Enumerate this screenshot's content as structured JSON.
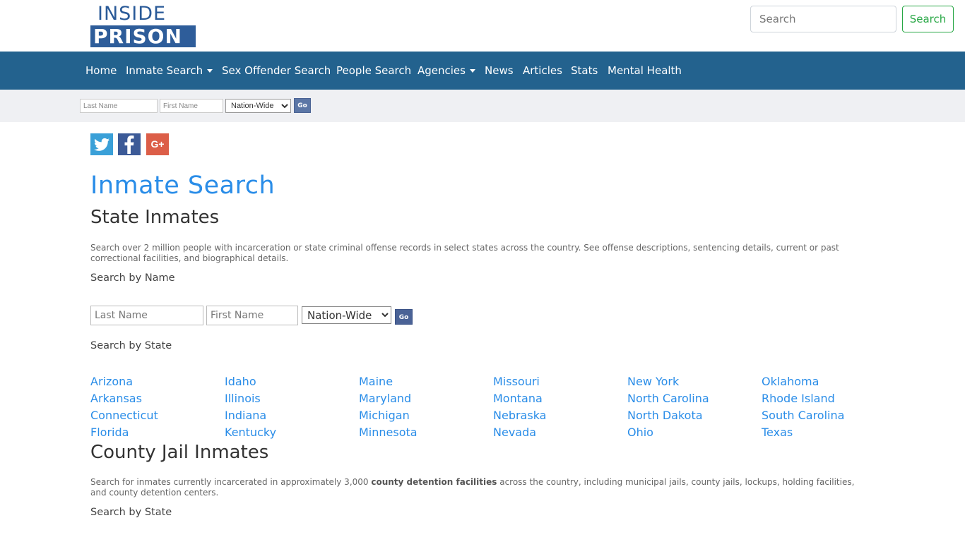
{
  "logo": {
    "top_text": "INSIDE",
    "bottom_text": "PRISON"
  },
  "nav": {
    "items": [
      {
        "label": "Home",
        "dropdown": false
      },
      {
        "label": "Inmate Search",
        "dropdown": true
      },
      {
        "label": "Sex Offender Search",
        "dropdown": false
      },
      {
        "label": "People Search",
        "dropdown": false
      },
      {
        "label": "Agencies",
        "dropdown": true
      },
      {
        "label": "News",
        "dropdown": false
      },
      {
        "label": "Articles",
        "dropdown": false
      },
      {
        "label": "Stats",
        "dropdown": false
      },
      {
        "label": "Mental Health",
        "dropdown": false
      }
    ],
    "search_placeholder": "Search",
    "search_button": "Search"
  },
  "quick_search": {
    "last_name_placeholder": "Last Name",
    "first_name_placeholder": "First Name",
    "scope_selected": "Nation-Wide",
    "go_label": "Go"
  },
  "social": {
    "twitter": "twitter-icon",
    "facebook": "facebook-icon",
    "google_plus": "google-plus-icon"
  },
  "page_title": "Inmate Search",
  "state_section": {
    "heading": "State Inmates",
    "description": "Search over 2 million people with incarceration or state criminal offense records in select states across the country. See offense descriptions, sentencing details, current or past correctional facilities, and biographical details.",
    "search_by_name": "Search by Name",
    "last_name_placeholder": "Last Name",
    "first_name_placeholder": "First Name",
    "scope_selected": "Nation-Wide",
    "go_label": "Go",
    "search_by_state": "Search by State",
    "states": [
      "Arizona",
      "Arkansas",
      "Connecticut",
      "Florida",
      "Idaho",
      "Illinois",
      "Indiana",
      "Kentucky",
      "Maine",
      "Maryland",
      "Michigan",
      "Minnesota",
      "Missouri",
      "Montana",
      "Nebraska",
      "Nevada",
      "New York",
      "North Carolina",
      "North Dakota",
      "Ohio",
      "Oklahoma",
      "Rhode Island",
      "South Carolina",
      "Texas"
    ]
  },
  "county_section": {
    "heading": "County Jail Inmates",
    "desc_before": "Search for inmates currently incarcerated in approximately 3,000 ",
    "desc_bold": "county detention facilities",
    "desc_after": " across the country, including municipal jails, county jails, lockups, holding facilities, and county detention centers.",
    "search_by_state": "Search by State"
  },
  "colors": {
    "navbar": "#23628e",
    "link": "#2a8de8",
    "subbar": "#eff0f3",
    "search_button": "#28a745"
  }
}
